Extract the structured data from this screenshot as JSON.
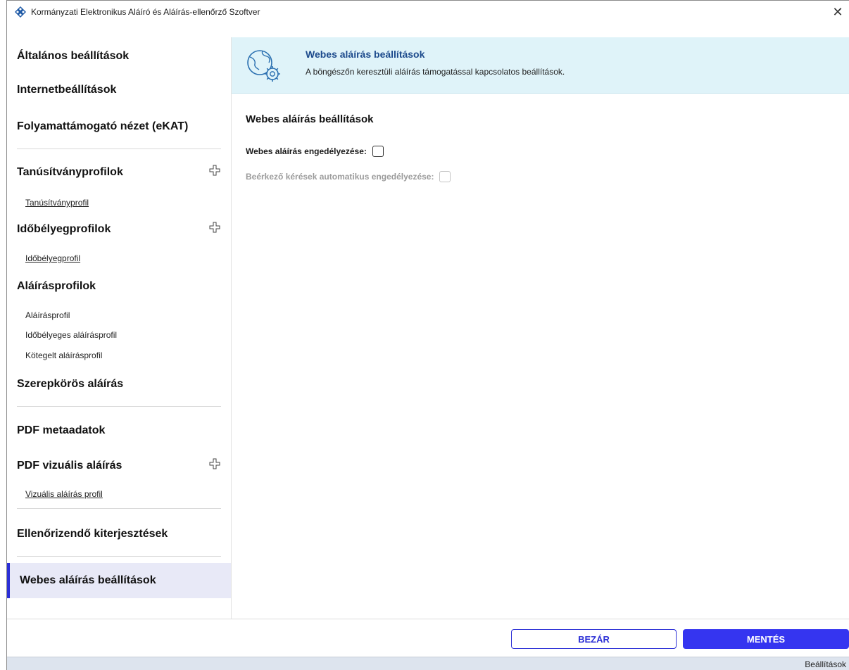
{
  "window": {
    "title": "Kormányzati Elektronikus Aláíró és Aláírás-ellenőrző Szoftver",
    "close_glyph": "✕"
  },
  "sidebar": {
    "general": "Általános beállítások",
    "internet": "Internetbeállítások",
    "ekat": "Folyamattámogató nézet (eKAT)",
    "cert_profiles": "Tanúsítványprofilok",
    "cert_profile_item": "Tanúsítványprofil",
    "timestamp_profiles": "Időbélyegprofilok",
    "timestamp_profile_item": "Időbélyegprofil",
    "signature_profiles": "Aláírásprofilok",
    "signature_profile_item": "Aláírásprofil",
    "timestamped_signature_profile": "Időbélyeges aláírásprofil",
    "batch_signature_profile": "Kötegelt aláírásprofil",
    "role_signature": "Szerepkörös aláírás",
    "pdf_metadata": "PDF metaadatok",
    "pdf_visual_signature": "PDF vizuális aláírás",
    "visual_signature_profile": "Vizuális aláírás profil",
    "extensions": "Ellenőrizendő kiterjesztések",
    "web_signature_settings": "Webes aláírás beállítások"
  },
  "banner": {
    "title": "Webes aláírás beállítások",
    "description": "A böngészőn keresztüli aláírás támogatással kapcsolatos beállítások."
  },
  "content": {
    "section_title": "Webes aláírás beállítások",
    "enable_web_signature_label": "Webes aláírás engedélyezése:",
    "enable_web_signature_checked": false,
    "auto_approve_label": "Beérkező kérések automatikus engedélyezése:",
    "auto_approve_checked": false,
    "auto_approve_disabled": true
  },
  "footer": {
    "close_label": "BEZÁR",
    "save_label": "MENTÉS"
  },
  "statusbar": {
    "text": "Beállítások"
  },
  "colors": {
    "accent": "#3535f0",
    "banner_bg": "#dff3f9",
    "active_nav_bg": "#e8e9f7",
    "banner_title": "#1c4a8c"
  }
}
